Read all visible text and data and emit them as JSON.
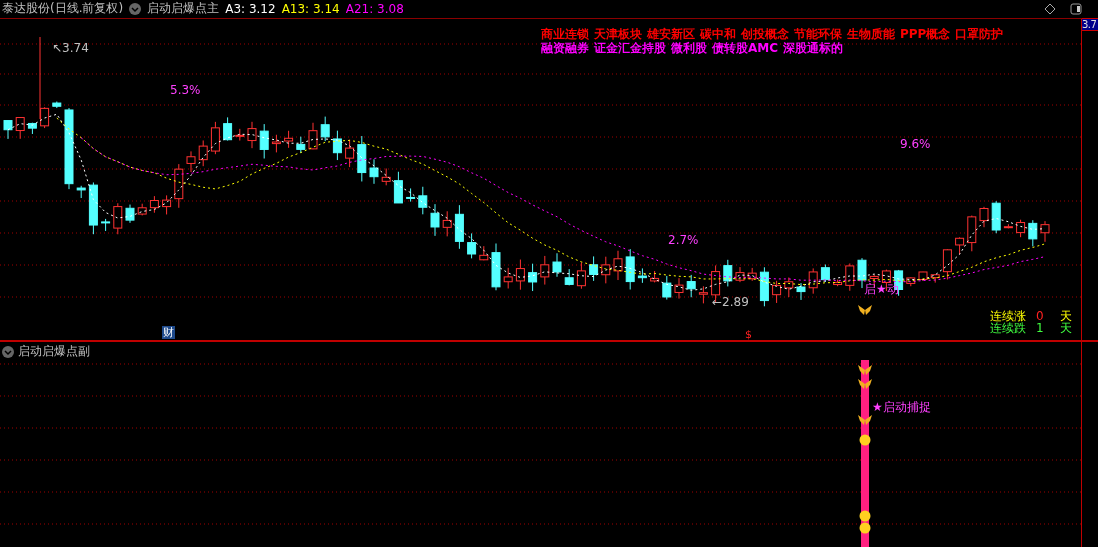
{
  "header": {
    "title": "泰达股份(日线.前复权)",
    "indicator": "启动启爆点主",
    "averages": [
      {
        "label": "A3:",
        "value": "3.12",
        "color": "#ffffff"
      },
      {
        "label": "A13:",
        "value": "3.14",
        "color": "#ffff00"
      },
      {
        "label": "A21:",
        "value": "3.08",
        "color": "#ff00ff"
      }
    ]
  },
  "main_chart": {
    "concept_lines": [
      {
        "color": "#ff0000",
        "tags": [
          "商业连锁",
          "天津板块",
          "雄安新区",
          "碳中和",
          "创投概念",
          "节能环保",
          "生物质能",
          "PPP概念",
          "口罩防护"
        ]
      },
      {
        "color": "#ff00ff",
        "tags": [
          "融资融券",
          "证金汇金持股",
          "微利股",
          "债转股AMC",
          "深股通标的"
        ]
      }
    ],
    "annotations": [
      {
        "kind": "high",
        "text": "↖3.74"
      },
      {
        "kind": "pct",
        "text": "5.3%"
      },
      {
        "kind": "pct",
        "text": "9.6%"
      },
      {
        "kind": "pct",
        "text": "2.7%"
      },
      {
        "kind": "low",
        "text": "←2.89"
      }
    ],
    "signal": "启★动",
    "markers": [
      {
        "kind": "finance",
        "text": "财"
      },
      {
        "kind": "dollar",
        "text": "$"
      }
    ],
    "streaks": [
      {
        "kind": "up",
        "label": "连续涨",
        "count": "0",
        "unit": "天"
      },
      {
        "kind": "down",
        "label": "连续跌",
        "count": "1",
        "unit": "天"
      }
    ]
  },
  "price_axis": {
    "label": "3.7"
  },
  "sub_chart": {
    "title": "启动启爆点副",
    "signal": "★启动捕捉"
  }
}
